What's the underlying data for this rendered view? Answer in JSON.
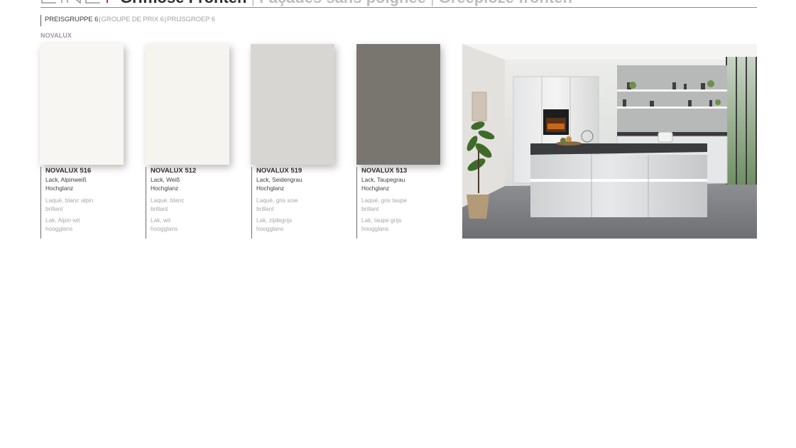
{
  "header": {
    "title_main": "Grifflose Fronten",
    "title_fr": "Façades sans poignée",
    "title_nl": "Greeploze fronten",
    "separator": "|"
  },
  "price_group": {
    "de": "PREISGRUPPE 6",
    "fr": "GROUPE DE PRIX 6",
    "nl": "PRIJSGROEP 6",
    "separator": "|"
  },
  "product_line": "NOVALUX",
  "swatches": [
    {
      "code": "NOVALUX 516",
      "name_de": "Lack, Alpinweiß",
      "finish_de": "Hochglanz",
      "name_fr": "Laqué, blanc alpin",
      "finish_fr": "brillant",
      "name_nl": "Lak, Alpin wit",
      "finish_nl": "hoogglans",
      "color": "#f7f6f2"
    },
    {
      "code": "NOVALUX 512",
      "name_de": "Lack, Weiß",
      "finish_de": "Hochglanz",
      "name_fr": "Laqué, blanc",
      "finish_fr": "brillant",
      "name_nl": "Lak, wit",
      "finish_nl": "hoogglans",
      "color": "#f5f4ee"
    },
    {
      "code": "NOVALUX 519",
      "name_de": "Lack, Seidengrau",
      "finish_de": "Hochglanz",
      "name_fr": "Laqué, gris soie",
      "finish_fr": "brillant",
      "name_nl": "Lak, zijdegrijs",
      "finish_nl": "hoogglans",
      "color": "#d8d6d3"
    },
    {
      "code": "NOVALUX 513",
      "name_de": "Lack, Taupegrau",
      "finish_de": "Hochglanz",
      "name_fr": "Laqué, gris taupe",
      "finish_fr": "brillant",
      "name_nl": "Lak, taupe grijs",
      "finish_nl": "hoogglans",
      "color": "#78766f"
    }
  ],
  "colors": {
    "accent": "#d7261e",
    "header_rule": "#8c8c8c"
  },
  "photo": {
    "subject": "kitchen-photo"
  }
}
